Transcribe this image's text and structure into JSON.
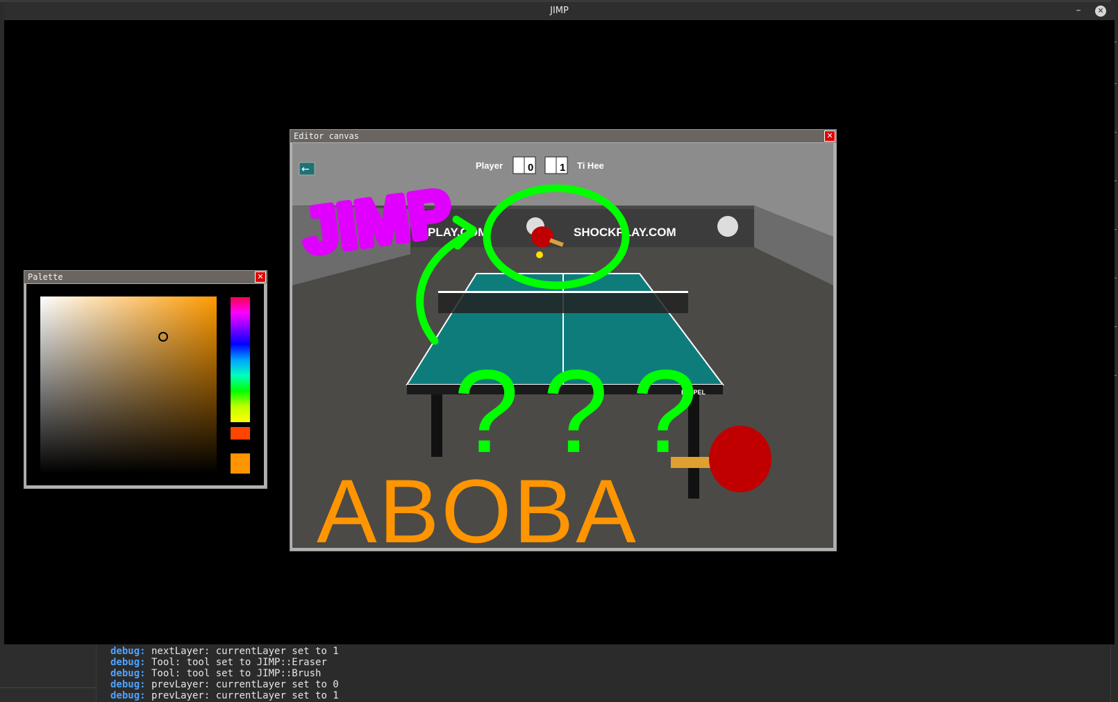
{
  "app": {
    "title": "JIMP",
    "minimize_glyph": "–",
    "close_glyph": "✕"
  },
  "palette": {
    "title": "Palette",
    "close_glyph": "✕",
    "selected_color": "#ff9500",
    "hue_selected_color": "#ff4500"
  },
  "editor": {
    "title": "Editor canvas",
    "close_glyph": "✕",
    "back_glyph": "←",
    "player_label": "Player",
    "player_score": "0",
    "opponent_score": "1",
    "opponent_label": "Ti Hee",
    "banner_left": "PLAY.COM",
    "banner_right": "SHOCKPLAY.COM",
    "table_brand": "ETSPEL",
    "drawing_jimp": "JIMP",
    "drawing_questions": "???",
    "drawing_aboba": "ABOBA",
    "colors": {
      "magenta": "#e000ff",
      "green": "#00ff00",
      "orange": "#ff9500",
      "table": "#0f7c7c"
    }
  },
  "console": {
    "lines": [
      {
        "level": "debug:",
        "text": " nextLayer: currentLayer set to 1"
      },
      {
        "level": "debug:",
        "text": " Tool: tool set to JIMP::Eraser"
      },
      {
        "level": "debug:",
        "text": " Tool: tool set to JIMP::Brush"
      },
      {
        "level": "debug:",
        "text": " prevLayer: currentLayer set to 0"
      },
      {
        "level": "debug:",
        "text": " prevLayer: currentLayer set to 1"
      }
    ]
  }
}
